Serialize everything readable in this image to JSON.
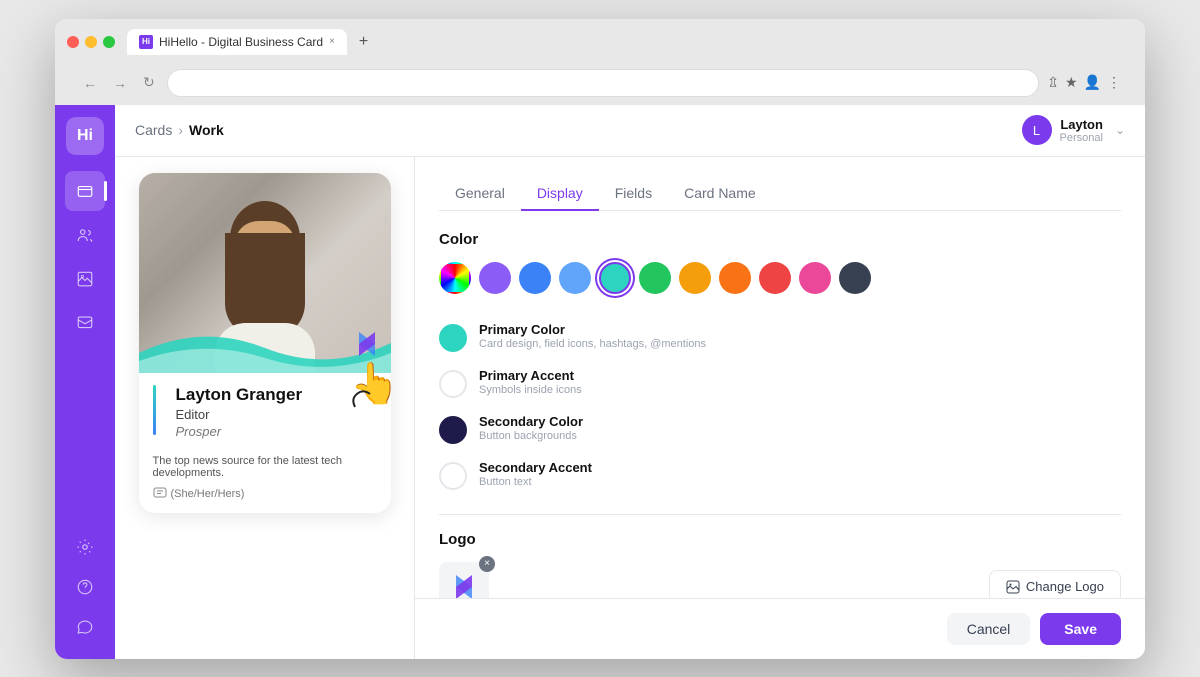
{
  "browser": {
    "tab_title": "HiHello - Digital Business Card",
    "tab_favicon": "Hi",
    "address_bar_text": ""
  },
  "breadcrumb": {
    "parent": "Cards",
    "current": "Work",
    "separator": "›"
  },
  "user": {
    "name": "Layton",
    "role": "Personal",
    "avatar_initial": "L"
  },
  "tabs": [
    {
      "id": "general",
      "label": "General",
      "active": false
    },
    {
      "id": "display",
      "label": "Display",
      "active": true
    },
    {
      "id": "fields",
      "label": "Fields",
      "active": false
    },
    {
      "id": "card-name",
      "label": "Card Name",
      "active": false
    }
  ],
  "color_section": {
    "title": "Color",
    "swatches": [
      {
        "id": "rainbow",
        "type": "rainbow",
        "label": "Rainbow"
      },
      {
        "id": "purple",
        "color": "#8b5cf6",
        "label": "Purple"
      },
      {
        "id": "blue",
        "color": "#3b82f6",
        "label": "Blue"
      },
      {
        "id": "light-blue",
        "color": "#60a5fa",
        "label": "Light Blue"
      },
      {
        "id": "teal",
        "color": "#2dd4bf",
        "label": "Teal",
        "selected": true
      },
      {
        "id": "green",
        "color": "#22c55e",
        "label": "Green"
      },
      {
        "id": "yellow",
        "color": "#f59e0b",
        "label": "Yellow"
      },
      {
        "id": "orange",
        "color": "#f97316",
        "label": "Orange"
      },
      {
        "id": "red",
        "color": "#ef4444",
        "label": "Red"
      },
      {
        "id": "pink",
        "color": "#ec4899",
        "label": "Pink"
      },
      {
        "id": "dark",
        "color": "#374151",
        "label": "Dark"
      }
    ],
    "options": [
      {
        "id": "primary-color",
        "label": "Primary Color",
        "description": "Card design, field icons, hashtags, @mentions",
        "color": "#2dd4bf",
        "border": false
      },
      {
        "id": "primary-accent",
        "label": "Primary Accent",
        "description": "Symbols inside icons",
        "color": "#ffffff",
        "border": true
      },
      {
        "id": "secondary-color",
        "label": "Secondary Color",
        "description": "Button backgrounds",
        "color": "#1e1b4b",
        "border": false
      },
      {
        "id": "secondary-accent",
        "label": "Secondary Accent",
        "description": "Button text",
        "color": "#ffffff",
        "border": true
      }
    ]
  },
  "logo_section": {
    "title": "Logo",
    "change_logo_label": "Change Logo",
    "remove_label": "×"
  },
  "card_preview": {
    "person_name": "Layton Granger",
    "person_title": "Editor",
    "person_company": "Prosper",
    "person_bio": "The top news source for the latest tech developments.",
    "person_pronouns": "(She/Her/Hers)"
  },
  "footer": {
    "cancel_label": "Cancel",
    "save_label": "Save"
  },
  "sidebar": {
    "logo_text": "Hi",
    "items": [
      {
        "id": "cards",
        "icon": "card",
        "active": true,
        "label": "Cards"
      },
      {
        "id": "contacts",
        "icon": "contacts",
        "active": false,
        "label": "Contacts"
      },
      {
        "id": "media",
        "icon": "media",
        "active": false,
        "label": "Media"
      },
      {
        "id": "messages",
        "icon": "messages",
        "active": false,
        "label": "Messages"
      },
      {
        "id": "settings",
        "icon": "settings",
        "active": false,
        "label": "Settings"
      },
      {
        "id": "help",
        "icon": "help",
        "active": false,
        "label": "Help"
      },
      {
        "id": "chat",
        "icon": "chat",
        "active": false,
        "label": "Chat"
      }
    ]
  }
}
